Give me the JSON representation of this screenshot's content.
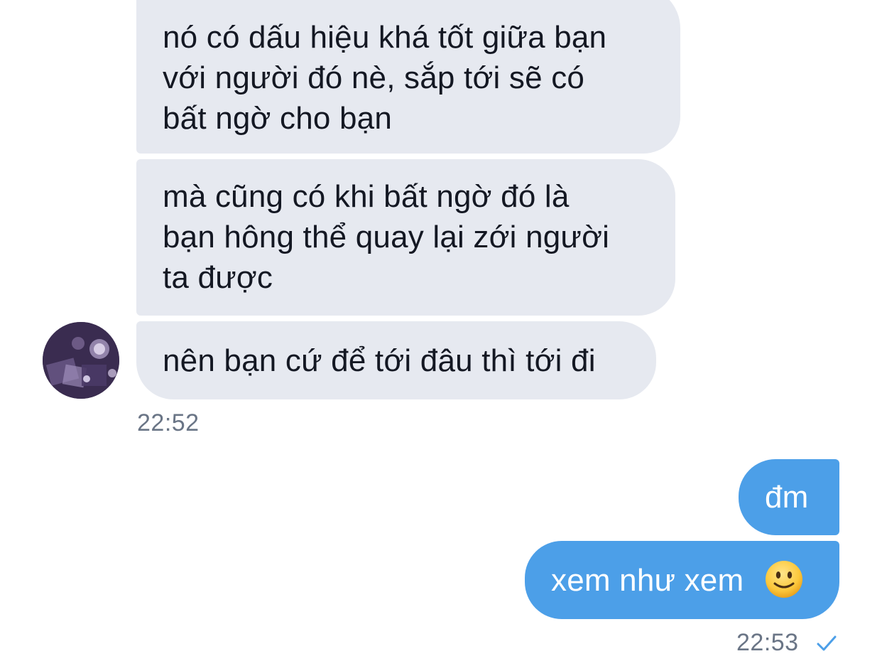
{
  "conversation": {
    "incoming": [
      {
        "lines": [
          "nó có dấu hiệu khá tốt giữa bạn",
          "với người đó nè, sắp tới sẽ có",
          "bất ngờ cho bạn"
        ]
      },
      {
        "lines": [
          "mà cũng có khi bất ngờ đó là",
          "bạn hông thể quay lại zới người",
          "ta được"
        ]
      },
      {
        "lines": [
          "nên bạn cứ để tới đâu thì tới đi"
        ]
      }
    ],
    "incoming_time": "22:52",
    "outgoing": [
      {
        "text": "đm"
      },
      {
        "text": "xem như xem",
        "emoji": "slightly-smiling-face"
      }
    ],
    "outgoing_time": "22:53",
    "read_status_icon": "check-icon"
  },
  "colors": {
    "incoming_bubble": "#e6e9f0",
    "outgoing_bubble": "#4c9fe8",
    "timestamp": "#6a7586"
  }
}
